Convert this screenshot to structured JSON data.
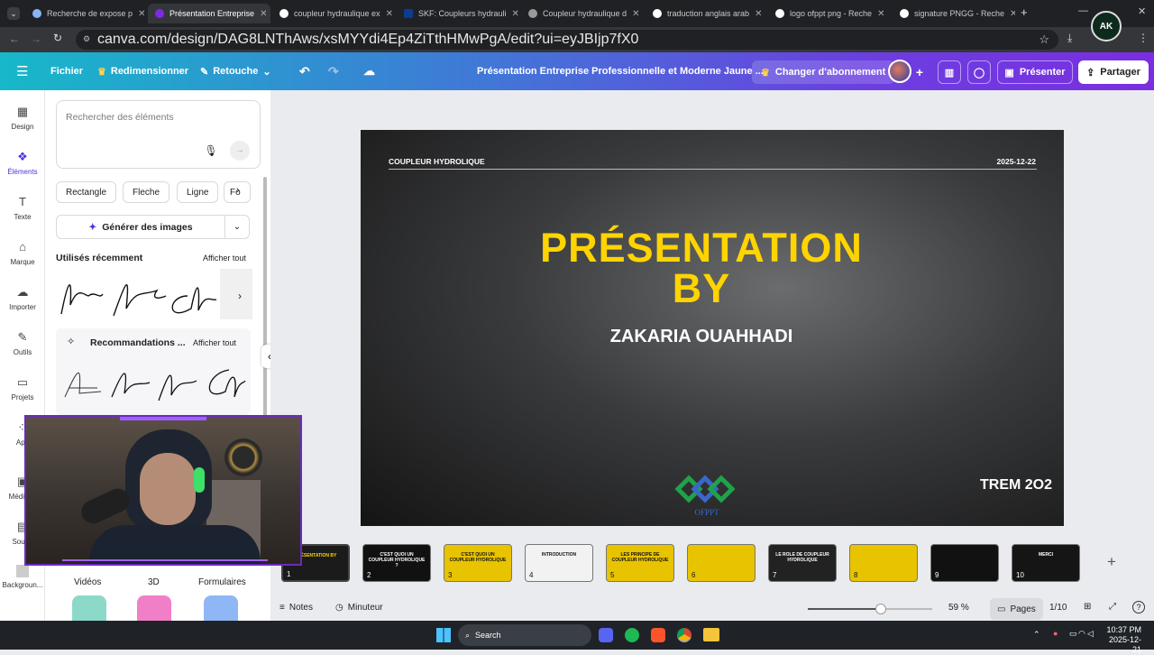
{
  "browser": {
    "tabs": [
      {
        "title": "Recherche de expose p",
        "active": false
      },
      {
        "title": "Présentation Entreprise",
        "active": true
      },
      {
        "title": "coupleur hydraulique ex",
        "active": false
      },
      {
        "title": "SKF: Coupleurs hydrauli",
        "active": false
      },
      {
        "title": "Coupleur hydraulique d",
        "active": false
      },
      {
        "title": "traduction anglais arab",
        "active": false
      },
      {
        "title": "logo ofppt png - Reche",
        "active": false
      },
      {
        "title": "signature PNGG - Reche",
        "active": false
      }
    ],
    "url": "canva.com/design/DAG8LNThAws/xsMYYdi4Ep4ZiTthHMwPgA/edit?ui=eyJBIjp7fX0",
    "profile_label": "AK"
  },
  "header": {
    "file_label": "Fichier",
    "resize_label": "Redimensionner",
    "edit_label": "Retouche",
    "doc_title": "Présentation Entreprise Professionnelle et Moderne Jaune ...",
    "upgrade_label": "Changer d'abonnement",
    "present_label": "Présenter",
    "share_label": "Partager"
  },
  "rail": [
    {
      "label": "Design",
      "icon": "layout-icon"
    },
    {
      "label": "Éléments",
      "icon": "shapes-icon"
    },
    {
      "label": "Texte",
      "icon": "text-icon"
    },
    {
      "label": "Marque",
      "icon": "brand-icon"
    },
    {
      "label": "Importer",
      "icon": "upload-icon"
    },
    {
      "label": "Outils",
      "icon": "tools-icon"
    },
    {
      "label": "Projets",
      "icon": "folder-icon"
    },
    {
      "label": "App",
      "icon": "apps-icon"
    },
    {
      "label": "Média m",
      "icon": "media-icon"
    },
    {
      "label": "Sous-t",
      "icon": "subtitle-icon"
    },
    {
      "label": "Backgroun...",
      "icon": "background-icon"
    }
  ],
  "panel": {
    "search_placeholder": "Rechercher des éléments",
    "chips": [
      "Rectangle",
      "Fleche",
      "Ligne",
      "Fo"
    ],
    "generate_label": "Générer des images",
    "recent_title": "Utilisés récemment",
    "see_all": "Afficher tout",
    "reco_title": "Recommandations ...",
    "reco_see_all": "Afficher tout",
    "categories": [
      "Vidéos",
      "3D",
      "Formulaires"
    ]
  },
  "slide": {
    "top_left": "COUPLEUR HYDROLIQUE",
    "top_right": "2025-12-22",
    "title_line1": "PRÉSENTATION",
    "title_line2": "BY",
    "subtitle": "ZAKARIA OUAHHADI",
    "logo_text": "OFPPT",
    "bottom_right": "TREM 2O2"
  },
  "thumbnails": [
    {
      "num": "1",
      "text": "PRÉSENTATION BY",
      "bg": "#1b1b1b"
    },
    {
      "num": "2",
      "text": "C'EST QUOI UN COUPLEUR HYDROLIQUE ?",
      "bg": "#111111"
    },
    {
      "num": "3",
      "text": "C'EST QUOI UN COUPLEUR HYDROLIQUE",
      "bg": "#e8c300"
    },
    {
      "num": "4",
      "text": "INTRODUCTION",
      "bg": "#f2f2f2"
    },
    {
      "num": "5",
      "text": "LES PRINCIPE DE COUPLEUR HYDROLIQUE",
      "bg": "#e8c300"
    },
    {
      "num": "6",
      "text": "",
      "bg": "#e8c300"
    },
    {
      "num": "7",
      "text": "LE ROLE DE COUPLEUR HYDROLIQUE",
      "bg": "#222222"
    },
    {
      "num": "8",
      "text": "",
      "bg": "#e8c300"
    },
    {
      "num": "9",
      "text": "",
      "bg": "#111111"
    },
    {
      "num": "10",
      "text": "MERCI",
      "bg": "#151515"
    }
  ],
  "bottom": {
    "notes_label": "Notes",
    "timer_label": "Minuteur",
    "zoom_label": "59 %",
    "zoom_value": 0.59,
    "pages_label": "Pages",
    "page_indicator": "1/10"
  },
  "taskbar": {
    "search_label": "Search",
    "time": "10:37 PM",
    "date": "2025-12-21"
  },
  "colors": {
    "accent_yellow": "#ffd400",
    "header_start": "#17b8c9",
    "header_end": "#7a2ee0",
    "webcam_border": "#6a2bbf"
  }
}
